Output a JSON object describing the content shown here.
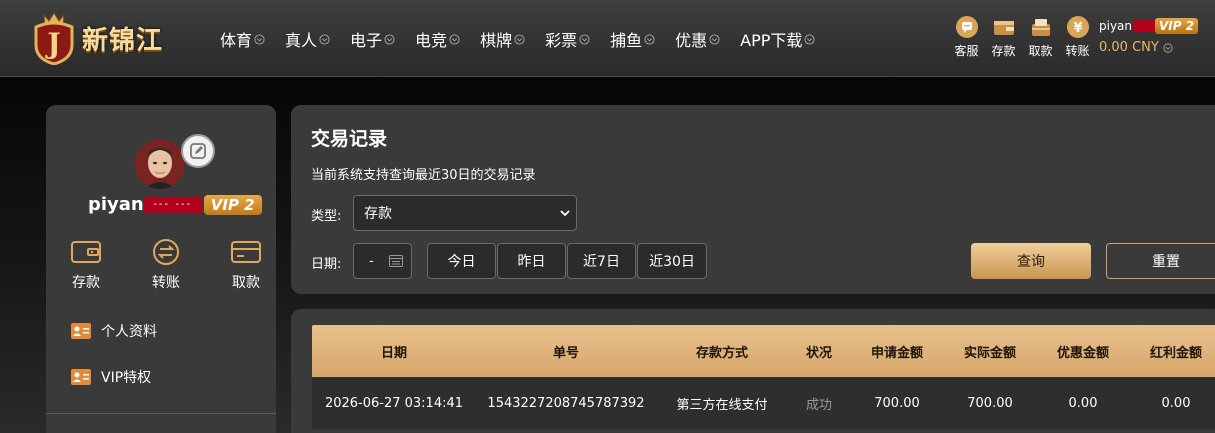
{
  "header": {
    "logo_text": "新锦江",
    "logo_letter": "J",
    "nav": [
      {
        "label": "体育"
      },
      {
        "label": "真人"
      },
      {
        "label": "电子"
      },
      {
        "label": "电竞"
      },
      {
        "label": "棋牌"
      },
      {
        "label": "彩票"
      },
      {
        "label": "捕鱼"
      },
      {
        "label": "优惠"
      },
      {
        "label": "APP下载"
      }
    ],
    "actions": [
      {
        "label": "客服",
        "icon": "customer-service-icon"
      },
      {
        "label": "存款",
        "icon": "wallet-icon"
      },
      {
        "label": "取款",
        "icon": "withdraw-icon"
      },
      {
        "label": "转账",
        "icon": "transfer-icon"
      }
    ],
    "user": {
      "name": "piyan",
      "vip": "VIP 2",
      "balance": "0.00 CNY"
    }
  },
  "sidebar": {
    "username": "piyan",
    "redacted": "--- ---",
    "vip": "VIP 2",
    "quick_actions": [
      {
        "label": "存款",
        "icon": "wallet-icon"
      },
      {
        "label": "转账",
        "icon": "transfer-icon"
      },
      {
        "label": "取款",
        "icon": "card-icon"
      }
    ],
    "menu": [
      {
        "label": "个人资料",
        "icon": "profile-card-icon"
      },
      {
        "label": "VIP特权",
        "icon": "vip-card-icon"
      }
    ]
  },
  "query": {
    "title": "交易记录",
    "subtitle": "当前系统支持查询最近30日的交易记录",
    "type_label": "类型:",
    "type_value": "存款",
    "date_label": "日期:",
    "date_value": "-",
    "ranges": [
      "今日",
      "昨日",
      "近7日",
      "近30日"
    ],
    "search_label": "查询",
    "reset_label": "重置"
  },
  "table": {
    "columns": [
      "日期",
      "单号",
      "存款方式",
      "状况",
      "申请金额",
      "实际金额",
      "优惠金额",
      "红利金额"
    ],
    "rows": [
      [
        "2026-06-27 03:14:41",
        "1543227208745787392",
        "第三方在线支付",
        "成功",
        "700.00",
        "700.00",
        "0.00",
        "0.00"
      ]
    ]
  },
  "colors": {
    "accent": "#d7a66a",
    "vip": "#c07a18",
    "redact": "#b3001b"
  }
}
